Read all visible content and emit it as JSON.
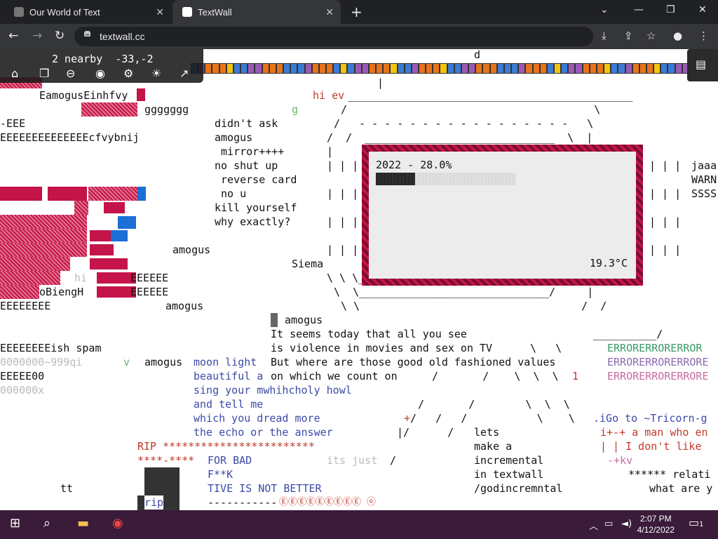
{
  "browser": {
    "tabs": [
      {
        "label": "Our World of Text",
        "active": false
      },
      {
        "label": "TextWall",
        "active": true
      }
    ],
    "url": "textwall.cc"
  },
  "overlay": {
    "nearby": "2 nearby  -33,-2"
  },
  "weather": {
    "year_progress": "2022 - 28.0%",
    "progress": 0.28,
    "temperature": "19.3°C"
  },
  "wall": {
    "l1": "EamogusEinhfvy",
    "l2": "ggggggg",
    "l3": "-EEE",
    "l4": "EEEEEEEEEEEEEEcfvybnij",
    "l5": "amogus",
    "l6": "hi ",
    "l7": "EEEEEE",
    "l8": "oBiengH",
    "l9": "EEEEEE",
    "l10": "EEEEEEEE",
    "l11": "amogus",
    "l12": "EEEEEEEEish spam",
    "l13": "0000000~999qi",
    "l14": "v",
    "l15": "EEEEE00",
    "l16": "000000x",
    "tt": "tt",
    "hi_ev": "hi ev",
    "g": "g",
    "d": "d",
    "c1": "didn't ask",
    "c2": "amogus",
    "c3": " mirror++++",
    "c4": "no shut up",
    "c5": " reverse card",
    "c6": " no u",
    "c7": "kill yourself",
    "c8": "why exactly?",
    "siema": "Siema",
    "j1": "jaaa",
    "j2": "WARN",
    "j3": "SSSS",
    "amogus2": "amogus",
    "s1": "It seems today that all you see",
    "s2": "is violence in movies and sex on TV",
    "s3": "But where are those good old fashioned values",
    "s4": "on which we count on",
    "amogus3": "amogus",
    "moon": "moon light",
    "beautiful": "beautiful a",
    "sing": "sing your mwhihcholy howl",
    "andtell": "and tell me",
    "which": "which you dread more",
    "echo": "the echo or the answer",
    "rip": "RIP ************************",
    "forbad": "****-****",
    "forbad2": "FOR BAD",
    "its": "its just",
    "fk": "F**K",
    "tive": "TIVE IS NOT BETTER",
    "ripbox": "rip",
    "dashes": "-----------",
    "e1": "ERRORERRORERROR",
    "e2": "ERRORERRORERRORE",
    "e3": "ERRORERRORERRORE",
    "one": "1",
    "r1": "lets",
    "r2": "make a",
    "r3": "incremental",
    "r4": "in textwall",
    "r5": "/godincremntal",
    "r6": ".iGo to ~Tricorn-g",
    "r7": "i+-+ a man who en",
    "r8": "| | I don't like",
    "r9": "-+kv",
    "r10": "****** relati",
    "r11": "what are y",
    "emoji": "ⒺⒺⒺⒺⒺⒺⒺⒺⒺ ⓞ",
    "hero": "||_______________________________________"
  },
  "taskbar": {
    "time": "2:07 PM",
    "date": "4/12/2022",
    "notifications": "1"
  },
  "colors": {
    "accent": "#c41449",
    "tabbar": "#202124",
    "taskbar": "#3a1b3a"
  }
}
